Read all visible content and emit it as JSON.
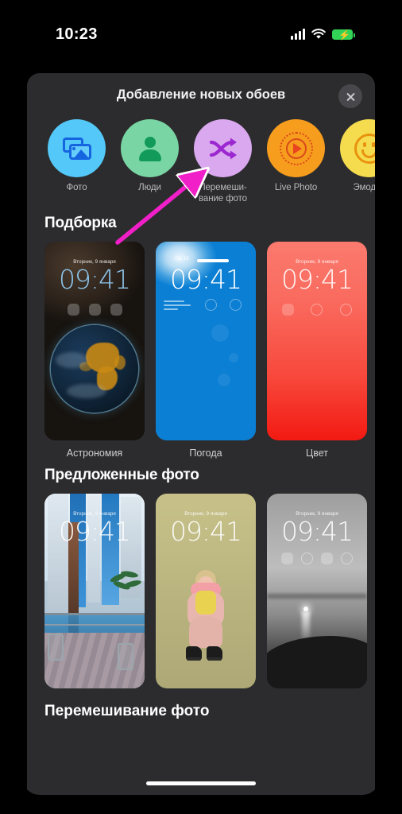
{
  "status_bar": {
    "time": "10:23",
    "icons": [
      "cellular-signal-icon",
      "wifi-icon",
      "battery-charging-icon"
    ]
  },
  "sheet": {
    "title": "Добавление новых обоев",
    "close_label": "✕"
  },
  "categories": [
    {
      "label": "Фото",
      "icon": "photos-icon",
      "color": "#54C8F8"
    },
    {
      "label": "Люди",
      "icon": "person-icon",
      "color": "#79D6A4"
    },
    {
      "label": "Перемеши-\nвание фото",
      "label_line1": "Перемеши-",
      "label_line2": "вание фото",
      "icon": "shuffle-icon",
      "color": "#D9A8EE"
    },
    {
      "label": "Live Photo",
      "icon": "live-photo-icon",
      "color": "#F79D1E"
    },
    {
      "label": "Эмодзи",
      "icon": "emoji-icon",
      "color": "#F5DC4E"
    }
  ],
  "sections": [
    {
      "title": "Подборка",
      "cards": [
        {
          "label": "Астрономия",
          "date": "Вторник, 9 января",
          "time": "09:41",
          "style": "astronomy"
        },
        {
          "label": "Погода",
          "date": "Ср, 15",
          "time": "09:41",
          "style": "weather"
        },
        {
          "label": "Цвет",
          "date": "Вторник, 9 января",
          "time": "09:41",
          "style": "color"
        }
      ]
    },
    {
      "title": "Предложенные фото",
      "cards": [
        {
          "label": "",
          "date": "Вторник, 9 января",
          "time": "09:41",
          "style": "city-photo"
        },
        {
          "label": "",
          "date": "Вторник, 9 января",
          "time": "09:41",
          "style": "kid-photo"
        },
        {
          "label": "",
          "date": "Вторник, 9 января",
          "time": "09:41",
          "style": "sea-photo"
        }
      ]
    }
  ],
  "bottom_section": {
    "title": "Перемешивание фото"
  },
  "annotation": {
    "arrow_color": "#F01FC8",
    "target": "shuffle-category-circle"
  }
}
